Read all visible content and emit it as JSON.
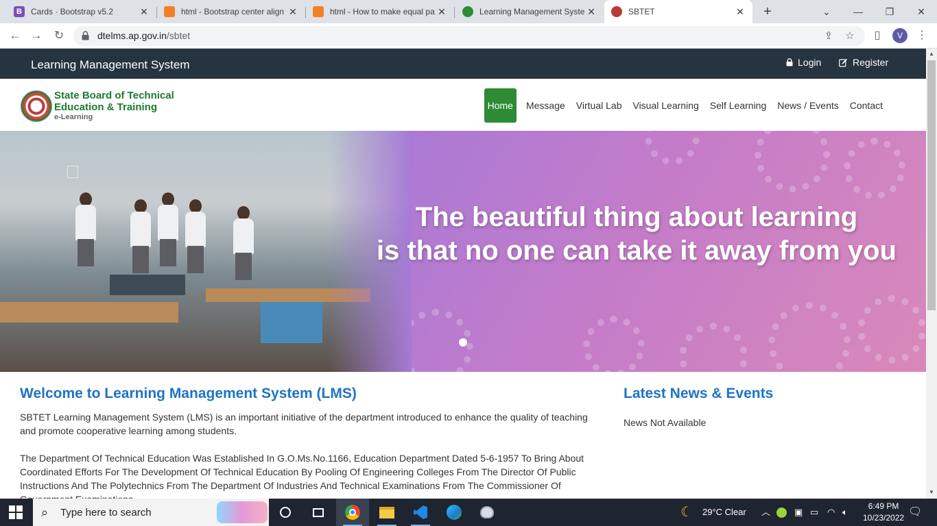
{
  "browser": {
    "tabs": [
      {
        "title": "Cards · Bootstrap v5.2",
        "favicon_letter": "B",
        "favicon_color": "#7952b3"
      },
      {
        "title": "html - Bootstrap center align",
        "favicon_letter": "",
        "favicon_color": "#f48024"
      },
      {
        "title": "html - How to make equal pa",
        "favicon_letter": "",
        "favicon_color": "#f48024"
      },
      {
        "title": "Learning Management Syste",
        "favicon_letter": "",
        "favicon_color": "#2e8b35"
      },
      {
        "title": "SBTET",
        "favicon_letter": "",
        "favicon_color": "#b83a3a"
      }
    ],
    "url_host": "dtelms.ap.gov.in",
    "url_path": "/sbtet",
    "profile_initial": "V"
  },
  "site": {
    "brand": "Learning Management System",
    "login_label": "Login",
    "register_label": "Register",
    "org_line1": "State Board of Technical",
    "org_line2": "Education & Training",
    "org_sub": "e-Learning",
    "nav": [
      "Home",
      "Message",
      "Virtual Lab",
      "Visual Learning",
      "Self Learning",
      "News / Events",
      "Contact"
    ],
    "hero_line1": "The beautiful thing about learning",
    "hero_line2": "is that no one can take it away from you",
    "welcome_title": "Welcome to Learning Management System (LMS)",
    "welcome_p1": "SBTET Learning Management System (LMS) is an important initiative of the department introduced to enhance the quality of teaching and promote cooperative learning among students.",
    "welcome_p2": "The Department Of Technical Education Was Established In G.O.Ms.No.1166, Education Department Dated 5-6-1957 To Bring About Coordinated Efforts For The Development Of Technical Education By Pooling Of Engineering Colleges From The Director Of Public Instructions And The Polytechnics From The Department Of Industries And Technical Examinations From The Commissioner Of Government Examinations.",
    "news_title": "Latest News & Events",
    "news_empty": "News Not Available"
  },
  "taskbar": {
    "search_placeholder": "Type here to search",
    "weather": "29°C  Clear",
    "time": "6:49 PM",
    "date": "10/23/2022"
  },
  "colors": {
    "topbar": "#263340",
    "nav_active": "#2e8b35",
    "heading_blue": "#1f73c4",
    "org_green": "#1d7a2e"
  }
}
